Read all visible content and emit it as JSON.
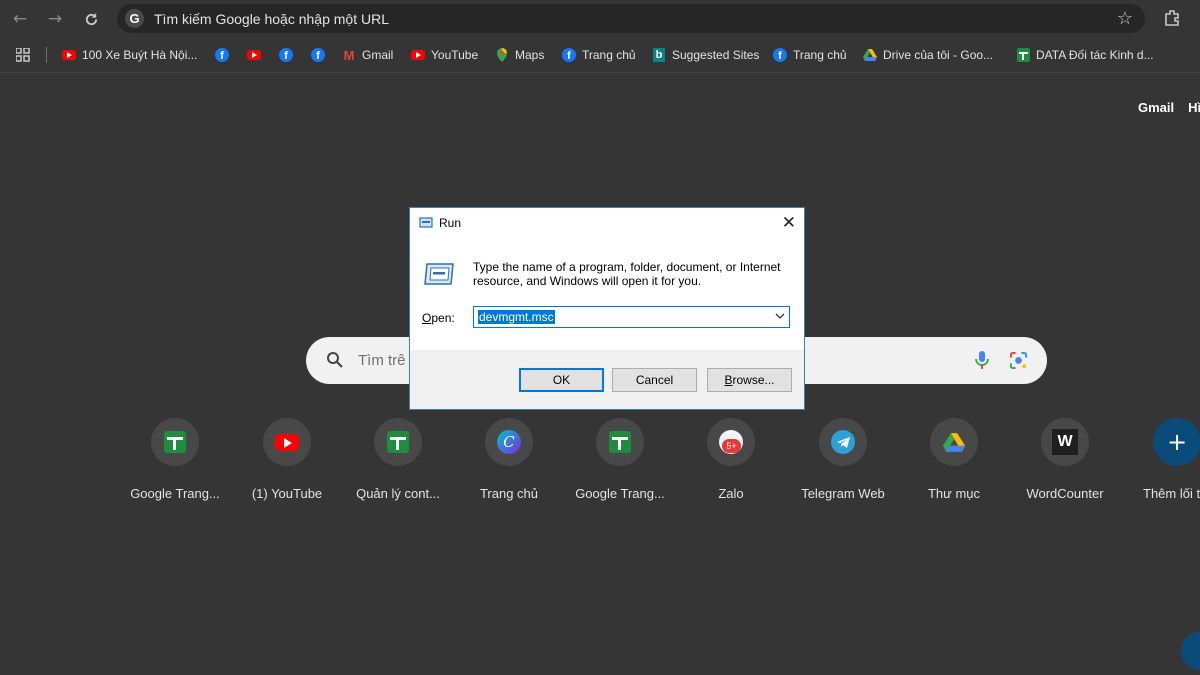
{
  "toolbar": {
    "omnibox_text": "Tìm kiếm Google hoặc nhập một URL",
    "back_icon": "back-arrow-icon",
    "forward_icon": "forward-arrow-icon",
    "reload_icon": "reload-icon"
  },
  "bookmarks": [
    {
      "label": "100 Xe Buýt Hà Nội...",
      "icon": "youtube-icon"
    },
    {
      "label": "",
      "icon": "facebook-icon"
    },
    {
      "label": "",
      "icon": "youtube-icon"
    },
    {
      "label": "",
      "icon": "facebook-icon"
    },
    {
      "label": "",
      "icon": "facebook-icon"
    },
    {
      "label": "Gmail",
      "icon": "gmail-icon"
    },
    {
      "label": "YouTube",
      "icon": "youtube-icon"
    },
    {
      "label": "Maps",
      "icon": "maps-icon"
    },
    {
      "label": "Trang chủ",
      "icon": "facebook-icon"
    },
    {
      "label": "Suggested Sites",
      "icon": "bing-icon"
    },
    {
      "label": "Trang chủ",
      "icon": "facebook-icon"
    },
    {
      "label": "Drive của tôi - Goo...",
      "icon": "drive-icon"
    },
    {
      "label": "DATA Đối tác Kinh d...",
      "icon": "sheets-icon"
    }
  ],
  "top_links": {
    "gmail": "Gmail",
    "images": "Hì"
  },
  "search": {
    "placeholder": "Tìm trê"
  },
  "shortcuts": [
    {
      "label": "Google Trang...",
      "icon": "sheets-icon"
    },
    {
      "label": "(1) YouTube",
      "icon": "youtube-icon"
    },
    {
      "label": "Quản lý cont...",
      "icon": "sheets-icon"
    },
    {
      "label": "Trang chủ",
      "icon": "canva-icon"
    },
    {
      "label": "Google Trang...",
      "icon": "sheets-icon"
    },
    {
      "label": "Zalo",
      "icon": "zalo-icon",
      "badge": "5+"
    },
    {
      "label": "Telegram Web",
      "icon": "telegram-icon"
    },
    {
      "label": "Thư mục",
      "icon": "drive-icon"
    },
    {
      "label": "WordCounter",
      "icon": "wordcounter-icon",
      "glyph": "W"
    },
    {
      "label": "Thêm lối t",
      "icon": "plus-icon",
      "glyph": "+"
    }
  ],
  "run_dialog": {
    "title": "Run",
    "description": "Type the name of a program, folder, document, or Internet resource, and Windows will open it for you.",
    "open_label_underlined": "O",
    "open_label_rest": "pen:",
    "input_value": "devmgmt.msc",
    "ok_label": "OK",
    "cancel_label": "Cancel",
    "browse_label_underlined": "B",
    "browse_label_rest": "rowse...",
    "close_glyph": "✕"
  },
  "colors": {
    "background": "#353535",
    "accent": "#0078d7",
    "youtube": "#ff0000",
    "facebook": "#1877f2"
  }
}
